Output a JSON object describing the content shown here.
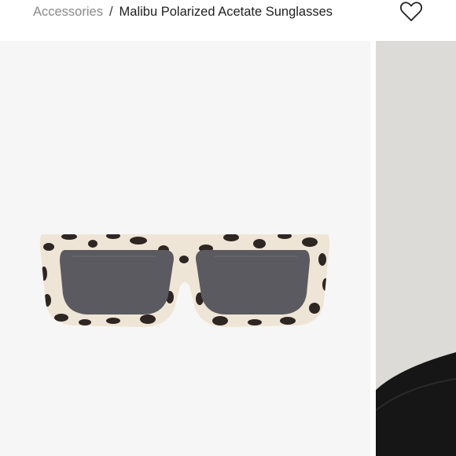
{
  "breadcrumb": {
    "parent": "Accessories",
    "separator": "/",
    "current": "Malibu Polarized Acetate Sunglasses"
  },
  "icons": {
    "wishlist": "heart-outline-icon"
  },
  "gallery": {
    "images": [
      {
        "name": "product-image-sunglasses",
        "active": true
      },
      {
        "name": "model-image",
        "active": false
      }
    ]
  },
  "colors": {
    "frame_base": "#efe5d6",
    "tortoise_spot": "#2d2622",
    "lens": "#5b5a60",
    "image_bg": "#f6f6f6",
    "side_bg": "#d9d7d3",
    "model_clothing": "#161616"
  }
}
